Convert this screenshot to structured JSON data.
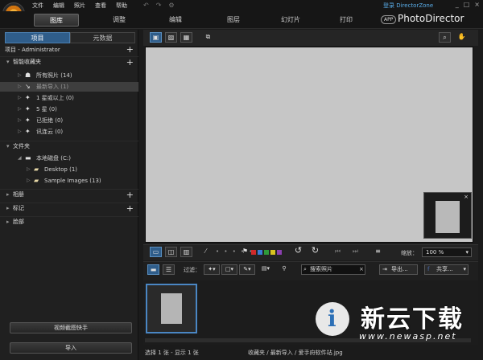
{
  "menu": [
    "文件",
    "编辑",
    "照片",
    "查看",
    "帮助"
  ],
  "login_text": "登录 DirectorZone",
  "window_controls": [
    "_",
    "□",
    "×"
  ],
  "modes": [
    {
      "label": "图库",
      "active": true
    },
    {
      "label": "调整",
      "active": false
    },
    {
      "label": "编辑",
      "active": false
    },
    {
      "label": "图层",
      "active": false
    },
    {
      "label": "幻灯片",
      "active": false
    },
    {
      "label": "打印",
      "active": false
    }
  ],
  "app_badge": "APP",
  "brand": "PhotoDirector",
  "left_tabs": [
    {
      "label": "项目",
      "active": true
    },
    {
      "label": "元数据",
      "active": false
    }
  ],
  "project_label": "项目 - Administrator",
  "sections": {
    "smart_collections": "智能收藏夹",
    "folders": "文件夹",
    "albums": "相册",
    "tags": "标记",
    "faces": "脸部"
  },
  "smart_items": [
    {
      "label": "所有照片 (14)",
      "icon": "people-icon"
    },
    {
      "label": "最新导入 (1)",
      "icon": "import-icon",
      "selected": true
    },
    {
      "label": "1 星或以上 (0)",
      "icon": "star-icon"
    },
    {
      "label": "5 星 (0)",
      "icon": "star-icon"
    },
    {
      "label": "已拒绝 (0)",
      "icon": "rejected-icon"
    },
    {
      "label": "讯连云 (0)",
      "icon": "cloud-icon"
    }
  ],
  "folder_items": [
    {
      "label": "本地磁盘 (C:)",
      "level": 1
    },
    {
      "label": "Desktop (1)",
      "level": 2
    },
    {
      "label": "Sample Images (13)",
      "level": 2
    }
  ],
  "left_buttons": {
    "quick_view": "视频截图快手",
    "import": "导入"
  },
  "zoom": {
    "label": "缩放：",
    "value": "100 %"
  },
  "filter": {
    "label": "过滤：",
    "search_placeholder": "搜索照片",
    "export_label": "导出...",
    "share_label": "共享..."
  },
  "color_labels": [
    "#d02a2a",
    "#3a7bd5",
    "#2e9a3a",
    "#d8c21f",
    "#8b3fb0"
  ],
  "status": {
    "selection": "选择 1 张 - 显示 1 张",
    "path": "收藏夹 / 最新导入 / 爱手府软件站.jpg"
  },
  "watermark": {
    "brand_cn": "新云下载",
    "url": "www.newasp.net",
    "letter": "i"
  }
}
